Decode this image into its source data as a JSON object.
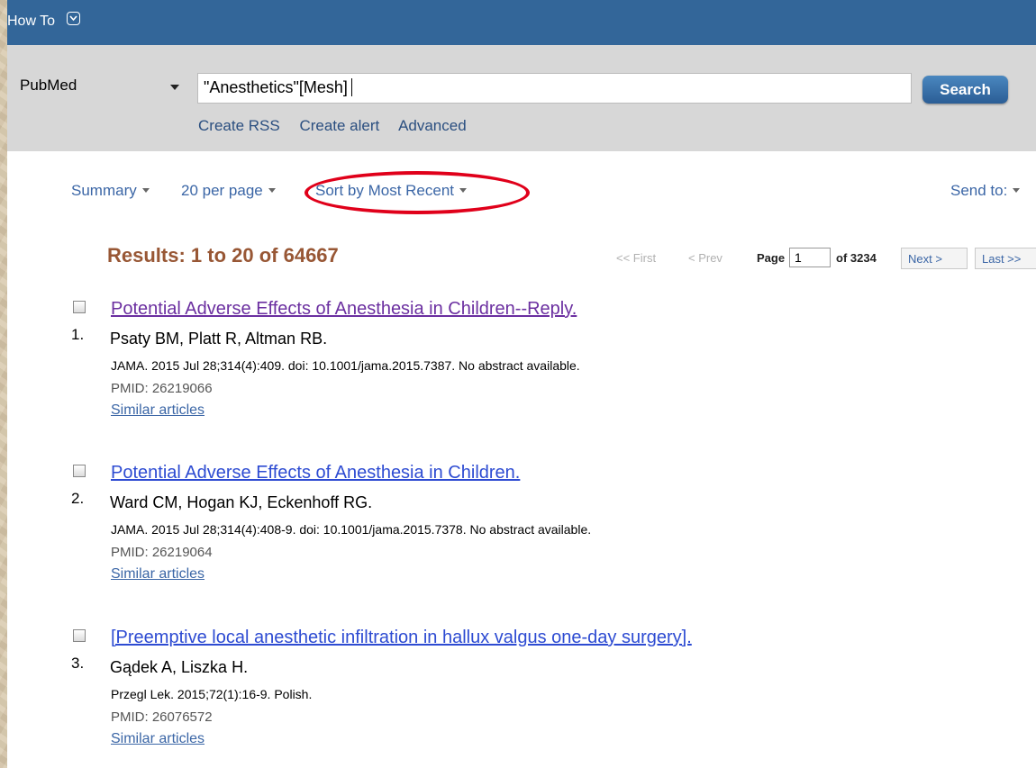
{
  "header": {
    "howto_label": "How To"
  },
  "search": {
    "database": "PubMed",
    "term": "\"Anesthetics\"[Mesh]",
    "button_label": "Search",
    "links": [
      "Create RSS",
      "Create alert",
      "Advanced"
    ]
  },
  "toolbar": {
    "format": "Summary",
    "per_page": "20 per page",
    "sort": "Sort by Most Recent",
    "send_to": "Send to:"
  },
  "results_heading": "Results: 1 to 20 of 64667",
  "pager": {
    "first": "<< First",
    "prev": "< Prev",
    "page_label": "Page",
    "page_value": "1",
    "of_label": "of 3234",
    "next": "Next >",
    "last": "Last >>"
  },
  "results": [
    {
      "number": "1.",
      "title": "Potential Adverse Effects of Anesthesia in Children--Reply.",
      "authors": "Psaty BM, Platt R, Altman RB.",
      "citation": "JAMA. 2015 Jul 28;314(4):409. doi: 10.1001/jama.2015.7387. No abstract available.",
      "pmid": "PMID: 26219066",
      "similar": "Similar articles"
    },
    {
      "number": "2.",
      "title": "Potential Adverse Effects of Anesthesia in Children.",
      "authors": "Ward CM, Hogan KJ, Eckenhoff RG.",
      "citation": "JAMA. 2015 Jul 28;314(4):408-9. doi: 10.1001/jama.2015.7378. No abstract available.",
      "pmid": "PMID: 26219064",
      "similar": "Similar articles"
    },
    {
      "number": "3.",
      "title": "[Preemptive local anesthetic infiltration in hallux valgus one-day surgery].",
      "authors": "Gądek A, Liszka H.",
      "citation": "Przegl Lek. 2015;72(1):16-9. Polish.",
      "pmid": "PMID: 26076572",
      "similar": "Similar articles"
    }
  ],
  "colors": {
    "header_bar": "#336699",
    "visited_link": "#6b2fa0",
    "link": "#2d4bd2",
    "results_heading": "#985735",
    "annotation_oval": "#e0001a"
  }
}
